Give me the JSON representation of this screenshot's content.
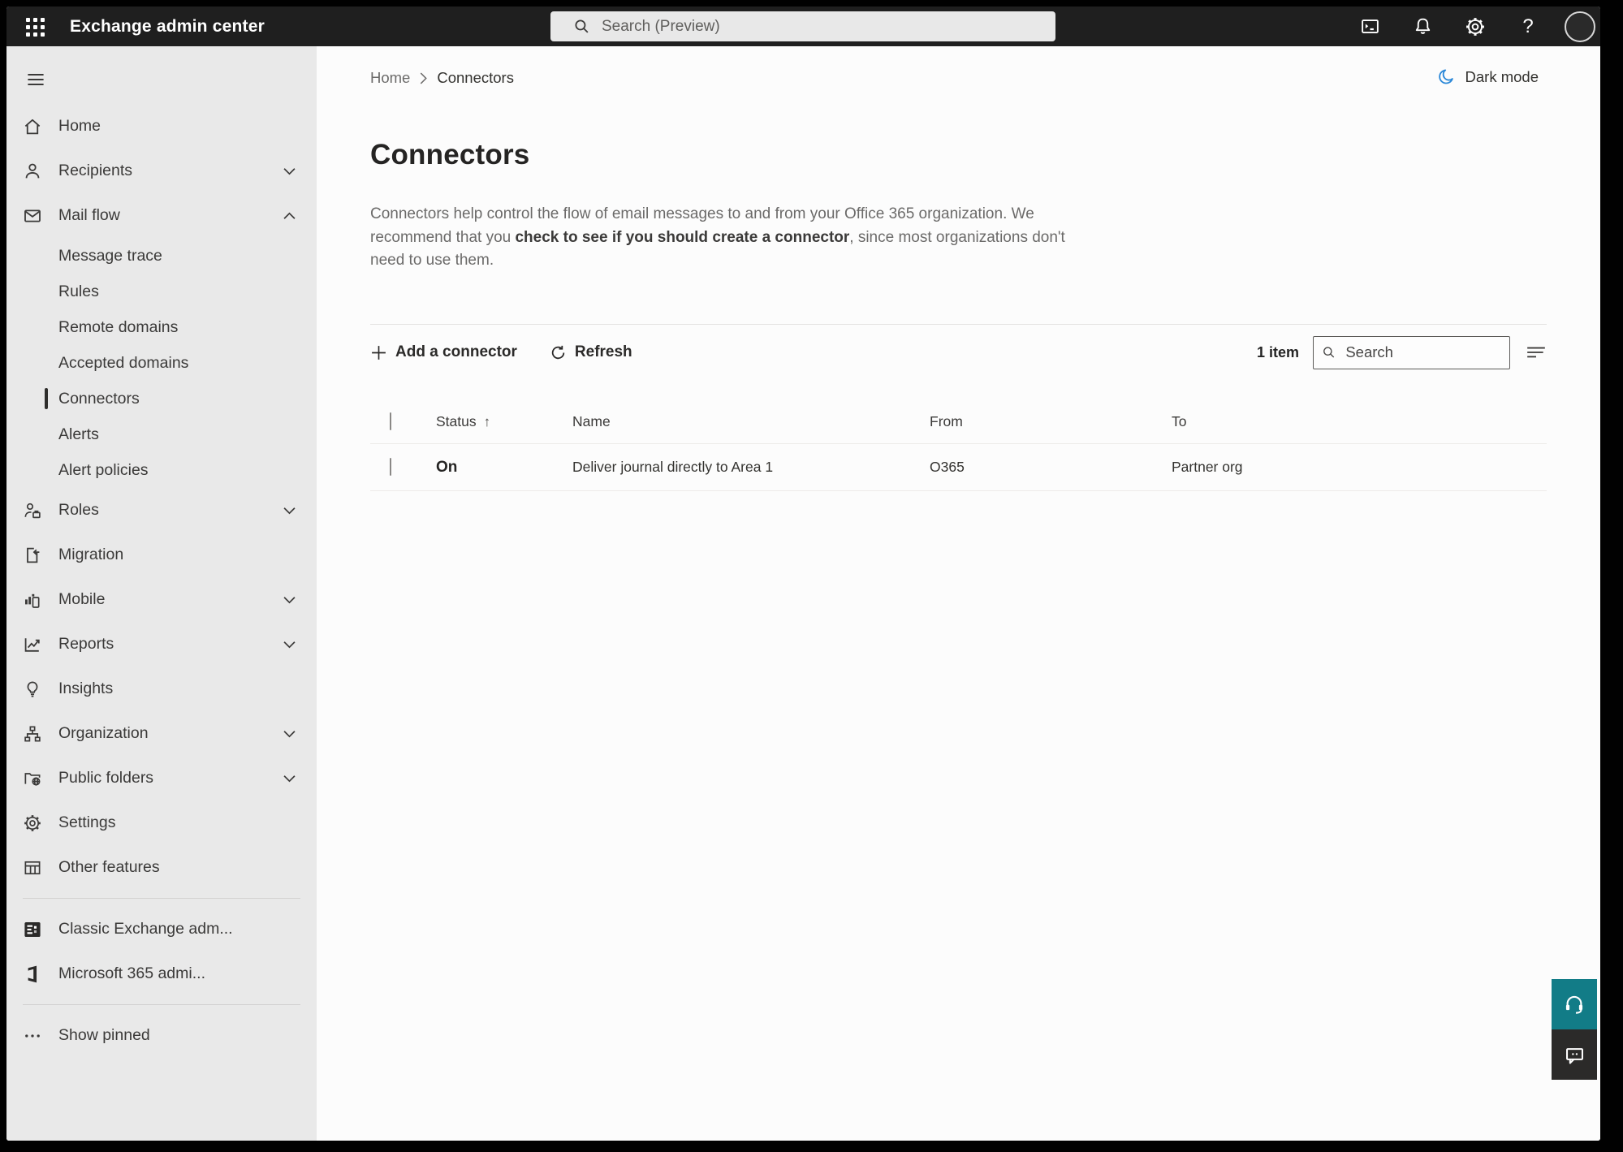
{
  "topbar": {
    "title": "Exchange admin center",
    "search_placeholder": "Search (Preview)",
    "help_glyph": "?"
  },
  "breadcrumb": {
    "home": "Home",
    "current": "Connectors"
  },
  "dark_mode_label": "Dark mode",
  "page": {
    "title": "Connectors",
    "description_1": "Connectors help control the flow of email messages to and from your Office 365 organization. We recommend that you ",
    "description_bold": "check to see if you should create a connector",
    "description_2": ", since most organizations don't need to use them."
  },
  "toolbar": {
    "add_label": "Add a connector",
    "refresh_label": "Refresh",
    "item_count": "1 item",
    "search_placeholder": "Search"
  },
  "table": {
    "sort_arrow": "↑",
    "headers": {
      "status": "Status",
      "name": "Name",
      "from": "From",
      "to": "To"
    },
    "rows": [
      {
        "status": "On",
        "name": "Deliver journal directly to Area 1",
        "from": "O365",
        "to": "Partner org"
      }
    ]
  },
  "sidebar": {
    "items": [
      {
        "label": "Home",
        "icon": "home-icon",
        "type": "top"
      },
      {
        "label": "Recipients",
        "icon": "people-icon",
        "type": "top",
        "chevron": "down"
      },
      {
        "label": "Mail flow",
        "icon": "mail-icon",
        "type": "top",
        "chevron": "up",
        "expanded": true
      },
      {
        "label": "Message trace",
        "type": "sub"
      },
      {
        "label": "Rules",
        "type": "sub"
      },
      {
        "label": "Remote domains",
        "type": "sub"
      },
      {
        "label": "Accepted domains",
        "type": "sub"
      },
      {
        "label": "Connectors",
        "type": "sub",
        "selected": true
      },
      {
        "label": "Alerts",
        "type": "sub"
      },
      {
        "label": "Alert policies",
        "type": "sub"
      },
      {
        "label": "Roles",
        "icon": "roles-icon",
        "type": "top",
        "chevron": "down"
      },
      {
        "label": "Migration",
        "icon": "migration-icon",
        "type": "top"
      },
      {
        "label": "Mobile",
        "icon": "mobile-icon",
        "type": "top",
        "chevron": "down"
      },
      {
        "label": "Reports",
        "icon": "reports-icon",
        "type": "top",
        "chevron": "down"
      },
      {
        "label": "Insights",
        "icon": "insights-icon",
        "type": "top"
      },
      {
        "label": "Organization",
        "icon": "organization-icon",
        "type": "top",
        "chevron": "down"
      },
      {
        "label": "Public folders",
        "icon": "public-folders-icon",
        "type": "top",
        "chevron": "down"
      },
      {
        "label": "Settings",
        "icon": "settings-icon",
        "type": "top"
      },
      {
        "label": "Other features",
        "icon": "other-features-icon",
        "type": "top"
      },
      {
        "label": "Classic Exchange adm...",
        "icon": "classic-exchange-icon",
        "type": "top"
      },
      {
        "label": "Microsoft 365 admi...",
        "icon": "microsoft-365-icon",
        "type": "top"
      },
      {
        "label": "Show pinned",
        "icon": "ellipsis-icon",
        "type": "top"
      }
    ]
  },
  "colors": {
    "topbar_bg": "#1f1f1f",
    "sidebar_bg": "#e9e9e9",
    "accent_moon_blue": "#2b88d8",
    "support_teal": "#127c87",
    "feedback_dark": "#2b2a29"
  }
}
